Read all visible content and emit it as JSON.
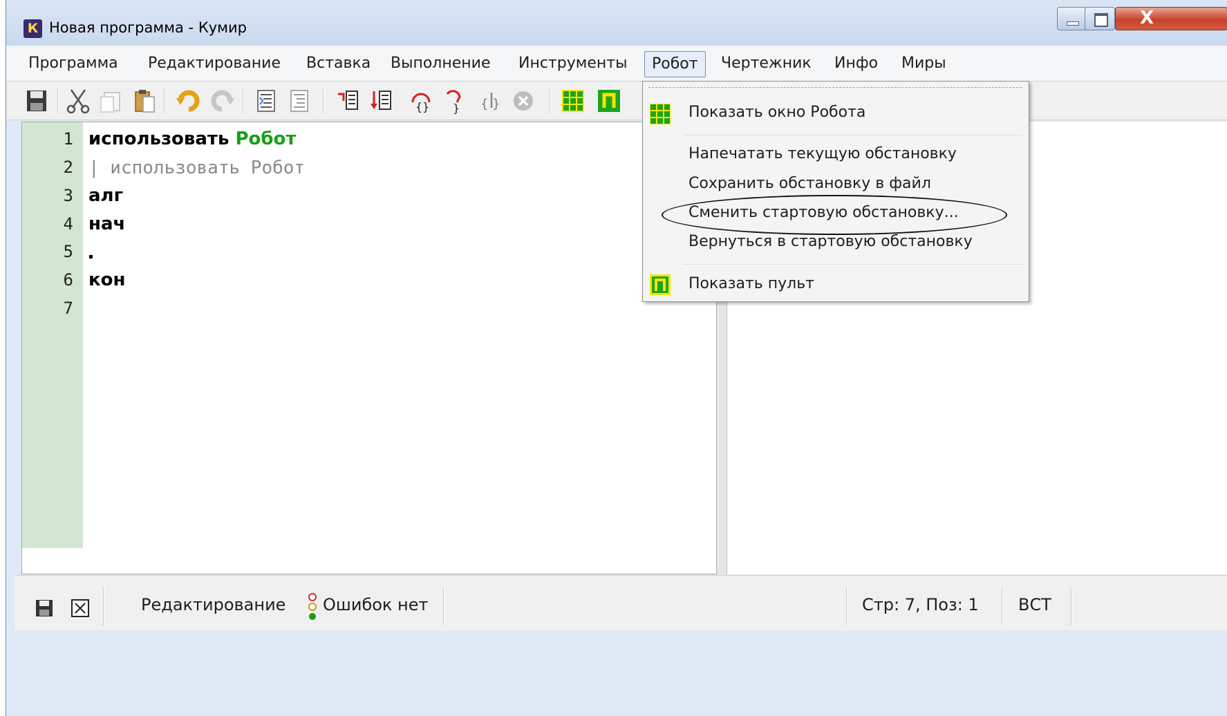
{
  "window": {
    "app_icon_letter": "К",
    "title": "Новая программа - Кумир"
  },
  "menubar": {
    "items": [
      "Программа",
      "Редактирование",
      "Вставка",
      "Выполнение",
      "Инструменты",
      "Робот",
      "Чертежник",
      "Инфо",
      "Миры"
    ],
    "active": "Робот"
  },
  "toolbar": {
    "icons": [
      "save-icon",
      "cut-icon",
      "copy-icon",
      "paste-icon",
      "undo-icon",
      "redo-icon",
      "indent-icon",
      "unindent-icon",
      "run-step-icon",
      "run-icon",
      "step-over-icon",
      "step-into-icon",
      "step-out-icon",
      "stop-icon",
      "robot-window-icon",
      "robot-remote-icon"
    ]
  },
  "editor": {
    "line_numbers": [
      "1",
      "2",
      "3",
      "4",
      "5",
      "6",
      "7"
    ],
    "line1_kw": "использовать",
    "line1_name": "Робот",
    "line2": "| использовать Робот",
    "line3": "алг",
    "line4": "нач",
    "line6": "кон"
  },
  "robot_menu": {
    "show_window": "Показать окно Робота",
    "print_state": "Напечатать текущую обстановку",
    "save_state": "Сохранить обстановку в файл",
    "change_start": "Сменить стартовую обстановку...",
    "reset_start": "Вернуться в стартовую обстановку",
    "show_remote": "Показать пульт"
  },
  "statusbar": {
    "mode": "Редактирование",
    "errors": "Ошибок нет",
    "position": "Стр: 7, Поз: 1",
    "insert_mode": "ВСТ"
  },
  "colors": {
    "keyword_green": "#1a9d1a",
    "gutter": "#d3e6d3",
    "robot_icon_green": "#1fa31f",
    "robot_icon_yellow": "#f2e600"
  }
}
